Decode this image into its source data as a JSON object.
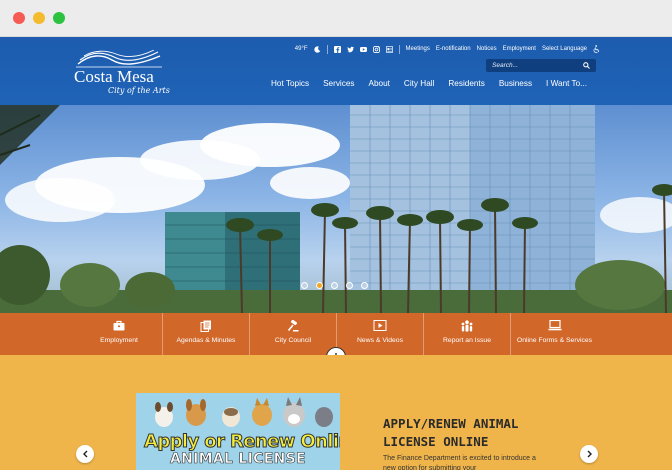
{
  "header": {
    "logo_name": "Costa Mesa",
    "logo_tagline": "City of the Arts",
    "weather": "49°F",
    "utility_links": [
      "Meetings",
      "E-notification",
      "Notices",
      "Employment",
      "Select Language"
    ],
    "search_placeholder": "Search...",
    "nav": [
      "Hot Topics",
      "Services",
      "About",
      "City Hall",
      "Residents",
      "Business",
      "I Want To..."
    ]
  },
  "hero": {
    "slide_count": 5,
    "active_slide": 2
  },
  "quick_links": [
    {
      "label": "Employment",
      "icon": "briefcase-icon"
    },
    {
      "label": "Agendas & Minutes",
      "icon": "documents-icon"
    },
    {
      "label": "City Council",
      "icon": "gavel-icon"
    },
    {
      "label": "News & Videos",
      "icon": "video-icon"
    },
    {
      "label": "Report an Issue",
      "icon": "people-icon"
    },
    {
      "label": "Online Forms & Services",
      "icon": "laptop-icon"
    }
  ],
  "feature": {
    "image_line1": "Apply or Renew Online",
    "image_line2": "ANIMAL LICENSE",
    "title": "APPLY/RENEW ANIMAL LICENSE ONLINE",
    "description": "The Finance Department is excited to introduce a new option for submitting your"
  },
  "colors": {
    "header_blue": "#1f63b7",
    "quick_bar_orange": "#d2672a",
    "feature_yellow": "#f0b54a"
  }
}
